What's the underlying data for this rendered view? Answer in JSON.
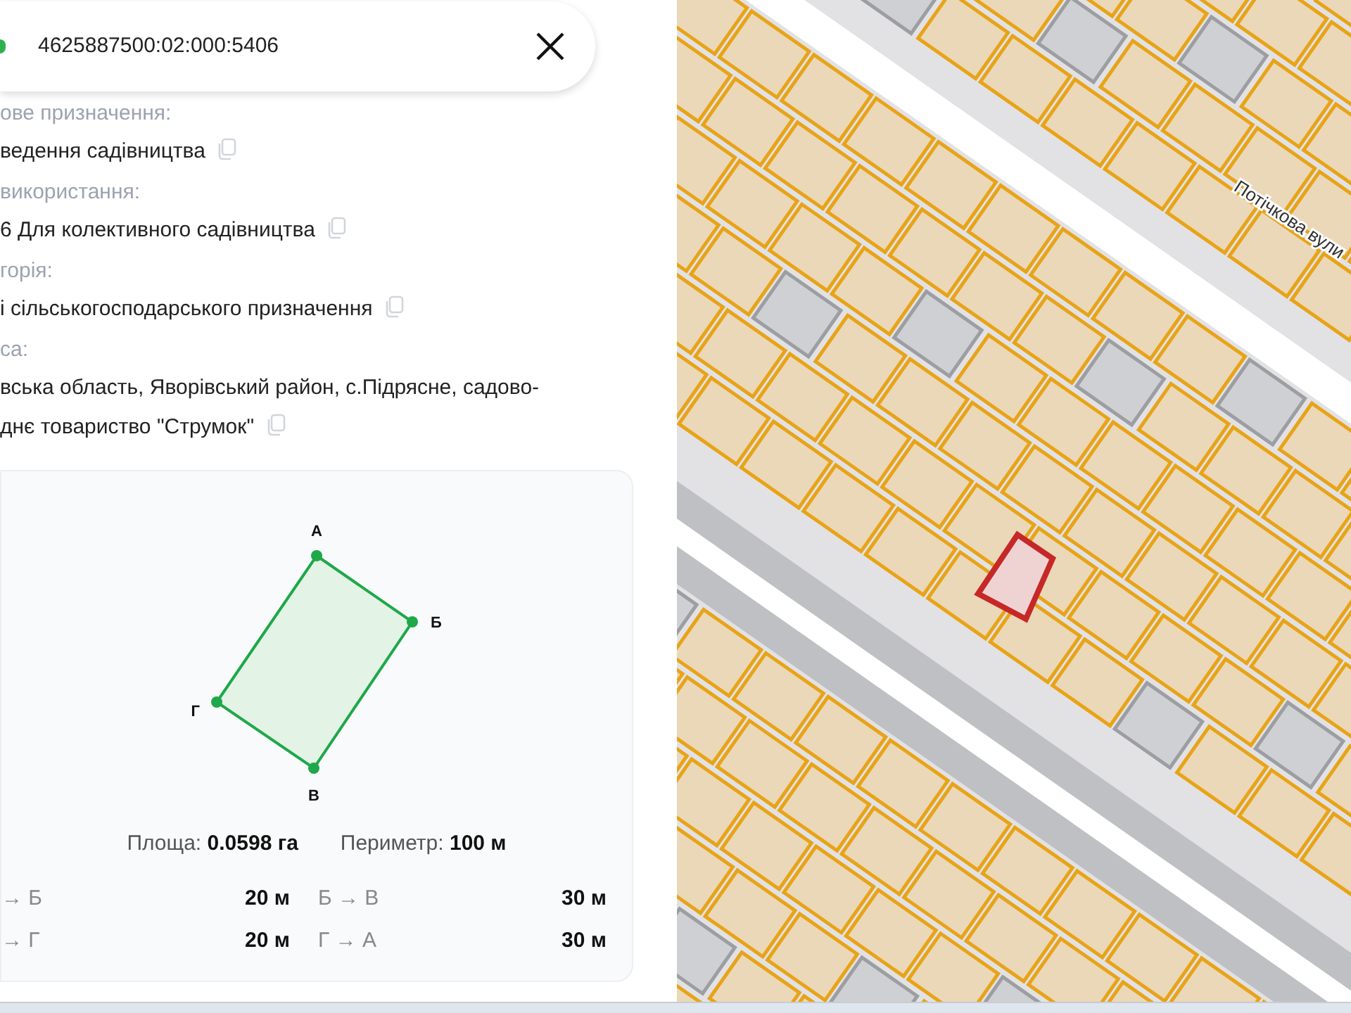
{
  "search": {
    "value": "4625887500:02:000:5406"
  },
  "fields": [
    {
      "label": "ове призначення:",
      "value": "ведення садівництва"
    },
    {
      "label": "використання:",
      "value": "6 Для колективного садівництва"
    },
    {
      "label": "горія:",
      "value": "і сільськогосподарського призначення"
    },
    {
      "label": "са:",
      "value": "вська область, Яворівський район, с.Підрясне, садово-днє товариство \"Струмок\""
    }
  ],
  "parcel_card": {
    "vertices": [
      "А",
      "Б",
      "В",
      "Г"
    ],
    "area_label": "Площа:",
    "area_value": "0.0598 га",
    "perimeter_label": "Периметр:",
    "perimeter_value": "100 м",
    "sides": [
      {
        "label": "→ Б",
        "length": "20 м"
      },
      {
        "label": "Б → В",
        "length": "30 м"
      },
      {
        "label": "→ Г",
        "length": "20 м"
      },
      {
        "label": "Г → А",
        "length": "30 м"
      }
    ]
  },
  "map": {
    "street_label": "Потічкова вули"
  }
}
